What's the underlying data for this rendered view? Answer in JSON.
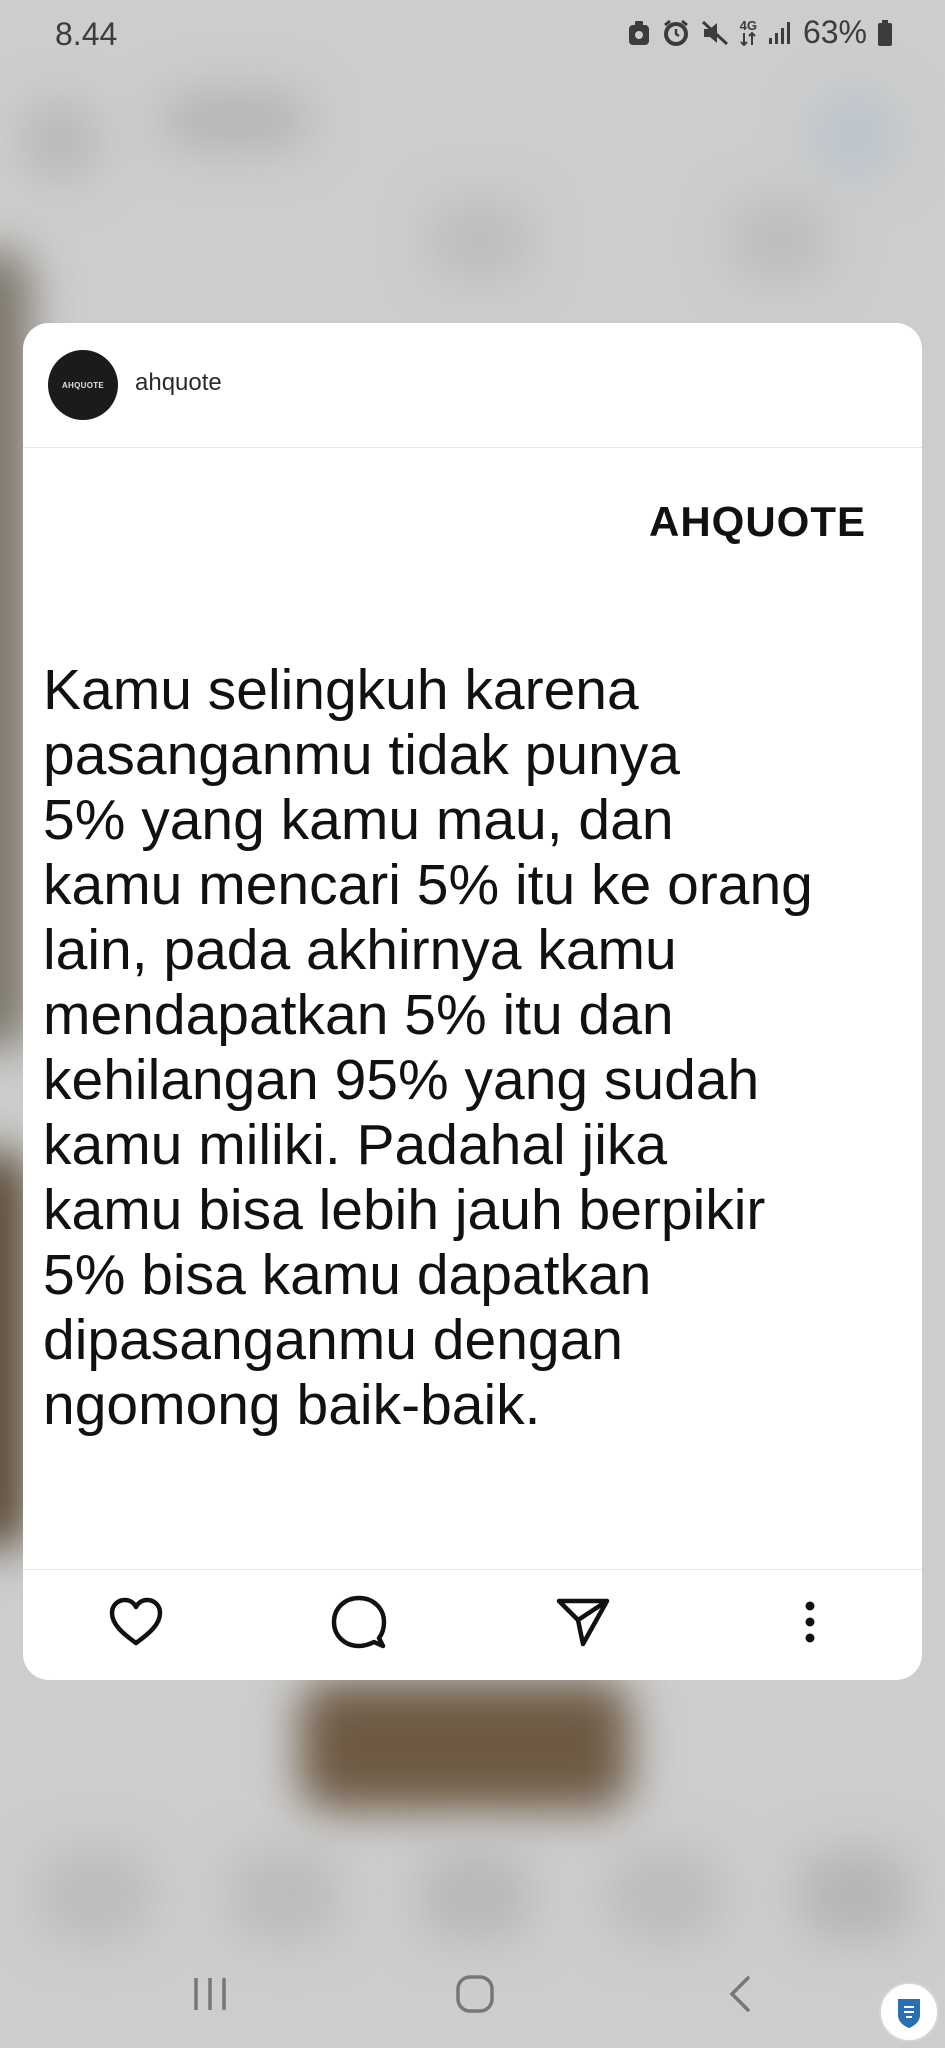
{
  "status_bar": {
    "time": "8.44",
    "network_label": "4G",
    "battery": "63%"
  },
  "post": {
    "username": "ahquote",
    "avatar_text": "AHQUOTE",
    "brand": "AHQUOTE",
    "quote_lines": [
      "Kamu selingkuh karena",
      "pasanganmu tidak punya",
      "5% yang kamu mau, dan",
      "kamu mencari 5% itu ke orang",
      "lain, pada akhirnya kamu",
      "mendapatkan 5% itu dan",
      "kehilangan 95% yang sudah",
      "kamu miliki. Padahal jika",
      "kamu bisa lebih jauh berpikir",
      "5% bisa kamu dapatkan",
      "dipasanganmu dengan",
      "ngomong baik-baik."
    ]
  },
  "actions": {
    "icons": [
      "heart-icon",
      "comment-icon",
      "send-icon",
      "more-icon"
    ]
  },
  "navigation": {
    "icons": [
      "recents-icon",
      "home-icon",
      "back-icon"
    ]
  },
  "colors": {
    "card_background": "#ffffff",
    "backdrop": "#cdcdcd",
    "text": "#111111"
  }
}
